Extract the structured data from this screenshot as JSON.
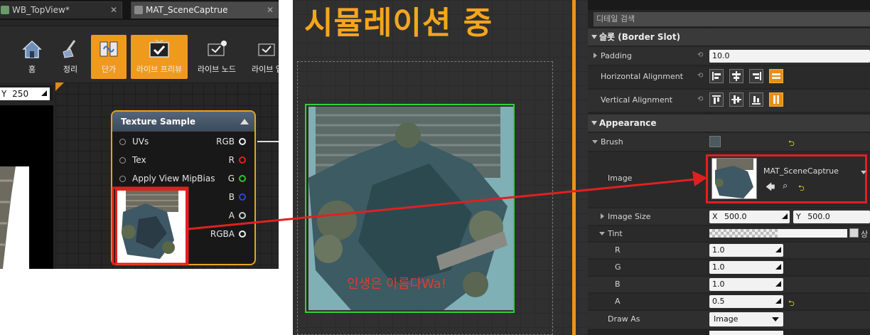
{
  "left_panel": {
    "tabs": [
      {
        "label": "WB_TopView*"
      },
      {
        "label": "MAT_SceneCaptrue"
      }
    ],
    "toolbar": [
      {
        "label": "홈",
        "icon": "house-icon"
      },
      {
        "label": "정리",
        "icon": "broom-icon"
      },
      {
        "label": "단가",
        "icon": "cable-icon",
        "active": true
      },
      {
        "label": "라이브 프리뷰",
        "icon": "tv-check-icon",
        "active": true
      },
      {
        "label": "라이브 노드",
        "icon": "node-tv-icon"
      },
      {
        "label": "라이브 업",
        "icon": "update-tv-icon"
      }
    ],
    "viewport_y_label": "Y",
    "viewport_y_value": "250",
    "node": {
      "title": "Texture Sample",
      "inputs": [
        "UVs",
        "Tex",
        "Apply View MipBias"
      ],
      "outputs": [
        "RGB",
        "R",
        "G",
        "B",
        "A",
        "RGBA"
      ],
      "output_colors": [
        "#eeeeee",
        "#e02020",
        "#28c828",
        "#2a46e0",
        "#cccccc",
        "#eeeeee"
      ]
    }
  },
  "middle_panel": {
    "title": "시뮬레이션 중",
    "scene_text": "인생은 아름다Wa!"
  },
  "details": {
    "search_placeholder": "디테일 검색",
    "slot_category": "슬롯 (Border Slot)",
    "padding_label": "Padding",
    "padding_value": "10.0",
    "halign_label": "Horizontal Alignment",
    "valign_label": "Vertical Alignment",
    "appearance_category": "Appearance",
    "brush_label": "Brush",
    "image_label": "Image",
    "image_asset": "MAT_SceneCaptrue",
    "image_size_label": "Image Size",
    "image_size_x_label": "X",
    "image_size_x": "500.0",
    "image_size_y_label": "Y",
    "image_size_y": "500.0",
    "tint_label": "Tint",
    "tint_extra": "상",
    "r_label": "R",
    "r_value": "1.0",
    "g_label": "G",
    "g_value": "1.0",
    "b_label": "B",
    "b_value": "1.0",
    "a_label": "A",
    "a_value": "0.5",
    "draw_as_label": "Draw As",
    "draw_as_value": "Image"
  },
  "colors": {
    "accent_orange": "#f09a1d",
    "highlight_red": "#e02020",
    "selection_green": "#2ed13a",
    "title_yellow": "#f5a51c"
  }
}
